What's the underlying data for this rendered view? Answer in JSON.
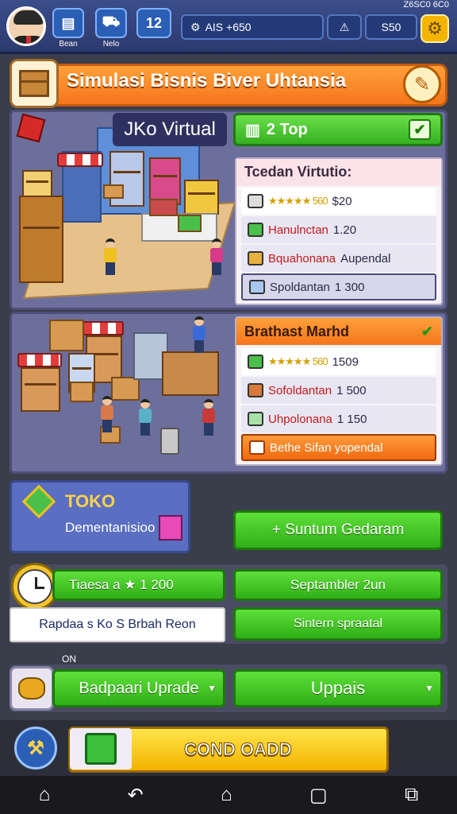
{
  "topbar": {
    "corner_text": "Z6SC0 6C0",
    "btn1_label": "Bean",
    "btn2_label": "Nelo",
    "btn3_value": "12",
    "money": "AIS +650",
    "stat2": "S50"
  },
  "title": "Simulasi Bisnis Biver Uhtansia",
  "panel1": {
    "virtual_tag": "JKo Virtual",
    "tab_label": "2 Top",
    "card": {
      "heading": "Tcedan Virtutio:",
      "rows": [
        {
          "stars": "★★★★★ 560",
          "value": "$20"
        },
        {
          "text": "Hanulnctan",
          "value": "1.20"
        },
        {
          "text": "Bquahonana",
          "value": "Aupendal"
        },
        {
          "text": "Spoldantan",
          "value": "1 300"
        }
      ]
    }
  },
  "panel2": {
    "card": {
      "heading": "Brathast Marhd",
      "rows": [
        {
          "stars": "★★★★★ 560",
          "value": "1509"
        },
        {
          "text": "Sofoldantan",
          "value": "1 500"
        },
        {
          "text": "Uhpolonana",
          "value": "1 150"
        }
      ],
      "button": "Bethe Sifan yopendal"
    }
  },
  "toko": {
    "title": "TOKO",
    "subtitle": "Dementanisioo"
  },
  "buttons": {
    "sunturn": "+ Suntum Gedaram",
    "tiaesa": "Tiaesa a ★ 1 200",
    "septambler": "Septambler 2un",
    "rapdlaa": "Rapdaa s Ko S Brbah Reon",
    "sintern": "Sintern spraatal",
    "on_label": "ON",
    "upgrade": "Badpaari Uprade",
    "uppais": "Uppais",
    "gold": "COND OADD"
  },
  "colors": {
    "accent_orange": "#f5761a",
    "accent_green": "#35b020",
    "panel": "#6c6f9c"
  }
}
